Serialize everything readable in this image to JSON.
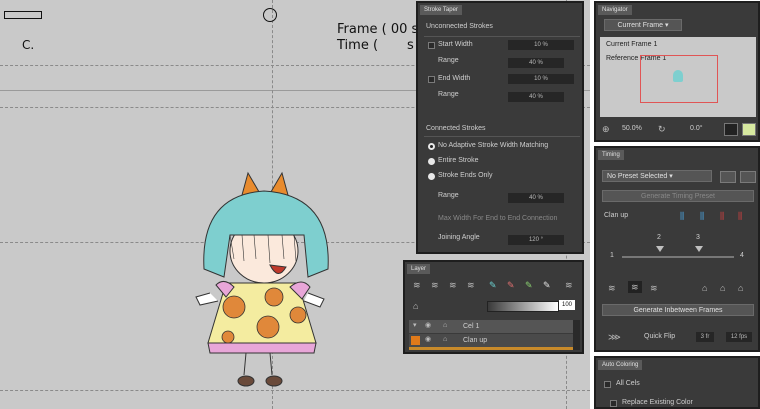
{
  "canvas": {
    "frame_label": "Frame ( 00 s",
    "time_label": "Time (       s",
    "corner_letter": "C."
  },
  "stroke_taper": {
    "tab": "Stroke Taper",
    "unconnected_header": "Unconnected Strokes",
    "start_width_label": "Start Width",
    "start_width_value": "10 %",
    "range_label": "Range",
    "range1_value": "40 %",
    "end_width_label": "End Width",
    "end_width_value": "10 %",
    "range2_value": "40 %",
    "connected_header": "Connected Strokes",
    "options": [
      "No Adaptive Stroke Width Matching",
      "Entire Stroke",
      "Stroke Ends Only"
    ],
    "range3_value": "40 %",
    "max_width_label": "Max Width For End to End Connection",
    "joining_angle_label": "Joining Angle",
    "joining_angle_value": "120 °"
  },
  "navigator": {
    "tab": "Navigator",
    "dropdown": "Current Frame",
    "current_frame": "Current Frame 1",
    "reference_frame": "Reference Frame 1",
    "zoom": "50.0%",
    "rotation": "0.0°"
  },
  "timing": {
    "tab": "Timing",
    "preset": "No Preset Selected",
    "generate_timing": "Generate Timing Preset",
    "clean_up": "Clan up",
    "ticks": [
      "1",
      "2",
      "3",
      "4"
    ],
    "generate_inbetween": "Generate Inbetween Frames",
    "quick_flip": "Quick Flip",
    "flip_frames": "3 fr",
    "fps": "12 fps"
  },
  "layer": {
    "tab": "Layer",
    "opacity": "100",
    "rows": [
      {
        "name": "Cel 1",
        "color": "#6e6e6e"
      },
      {
        "name": "Clan up",
        "color": "#e07a1a"
      }
    ]
  },
  "auto_coloring": {
    "tab": "Auto Coloring",
    "all_cels": "All Cels",
    "replace_existing": "Replace Existing Color"
  }
}
